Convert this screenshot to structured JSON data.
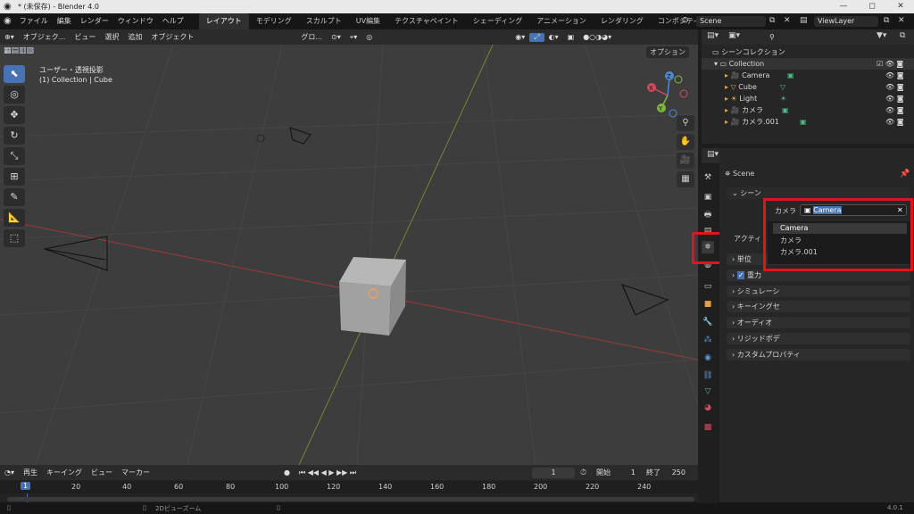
{
  "window": {
    "title": "* (未保存) - Blender 4.0",
    "min": "—",
    "max": "◻",
    "close": "✕"
  },
  "menu": [
    "ファイル",
    "編集",
    "レンダー",
    "ウィンドウ",
    "ヘルプ"
  ],
  "workspaces": [
    "レイアウト",
    "モデリング",
    "スカルプト",
    "UV編集",
    "テクスチャペイント",
    "シェーディング",
    "アニメーション",
    "レンダリング",
    "コンポジティング"
  ],
  "scene_field": "Scene",
  "view_layer_field": "ViewLayer",
  "viewport": {
    "header": [
      "オブジェク...",
      "ビュー",
      "選択",
      "追加",
      "オブジェクト",
      "グロ..."
    ],
    "options": "オプション",
    "info_line1": "ユーザー・透視投影",
    "info_line2": "(1) Collection | Cube",
    "gizmo": {
      "x": "X",
      "y": "Y",
      "z": "Z"
    }
  },
  "timeline": {
    "menu": [
      "再生",
      "キーイング",
      "ビュー",
      "マーカー"
    ],
    "current_frame": "1",
    "start_label": "開始",
    "start": "1",
    "end_label": "終了",
    "end": "250",
    "ticks": [
      "1",
      "20",
      "40",
      "60",
      "80",
      "100",
      "120",
      "140",
      "160",
      "180",
      "200",
      "220",
      "240"
    ]
  },
  "status": {
    "hint": "2Dビューズーム",
    "version": "4.0.1"
  },
  "outliner": {
    "scene_collection": "シーンコレクション",
    "collection": "Collection",
    "items": [
      "Camera",
      "Cube",
      "Light",
      "カメラ",
      "カメラ.001"
    ]
  },
  "properties": {
    "context": "Scene",
    "section": "シーン",
    "camera_label": "カメラ",
    "camera_value": "Camera",
    "active_label": "アクティ",
    "panels": [
      "単位",
      "重力",
      "シミュレーシ",
      "キーイングセ",
      "オーディオ",
      "リジッドボデ",
      "カスタムプロパティ"
    ],
    "dropdown": [
      "Camera",
      "カメラ",
      "カメラ.001"
    ]
  },
  "colors": {
    "accent": "#4772b3",
    "highlight": "#e1141e"
  }
}
